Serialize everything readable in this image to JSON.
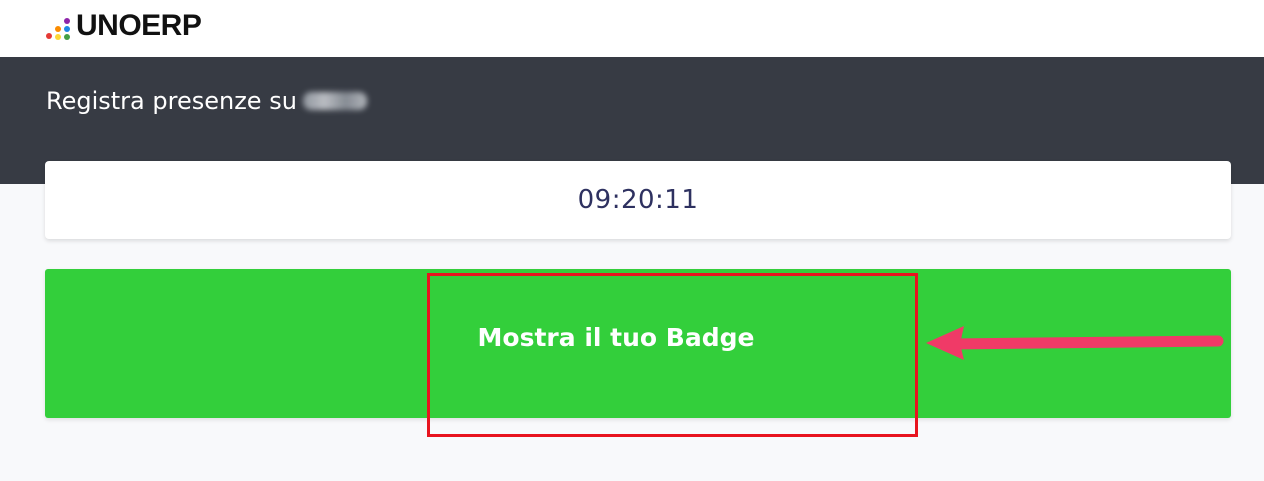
{
  "header": {
    "logo_text": "UNOERP",
    "logo_dot_colors": [
      "#e53935",
      "#fb8c00",
      "#fdd835",
      "#43a047",
      "#1e88e5",
      "#8e24aa"
    ]
  },
  "page": {
    "title": "Registra presenze su",
    "title_suffix_obscured": true
  },
  "clock": {
    "time": "09:20:11"
  },
  "actions": {
    "badge_button_label": "Mostra il tuo Badge"
  },
  "colors": {
    "band": "#373b44",
    "button": "#33cf3b",
    "highlight": "#e8141f",
    "arrow": "#f03a67",
    "clock_text": "#2e3160"
  },
  "annotations": {
    "highlight": "red-rectangle",
    "pointer": "pink-arrow-left"
  }
}
